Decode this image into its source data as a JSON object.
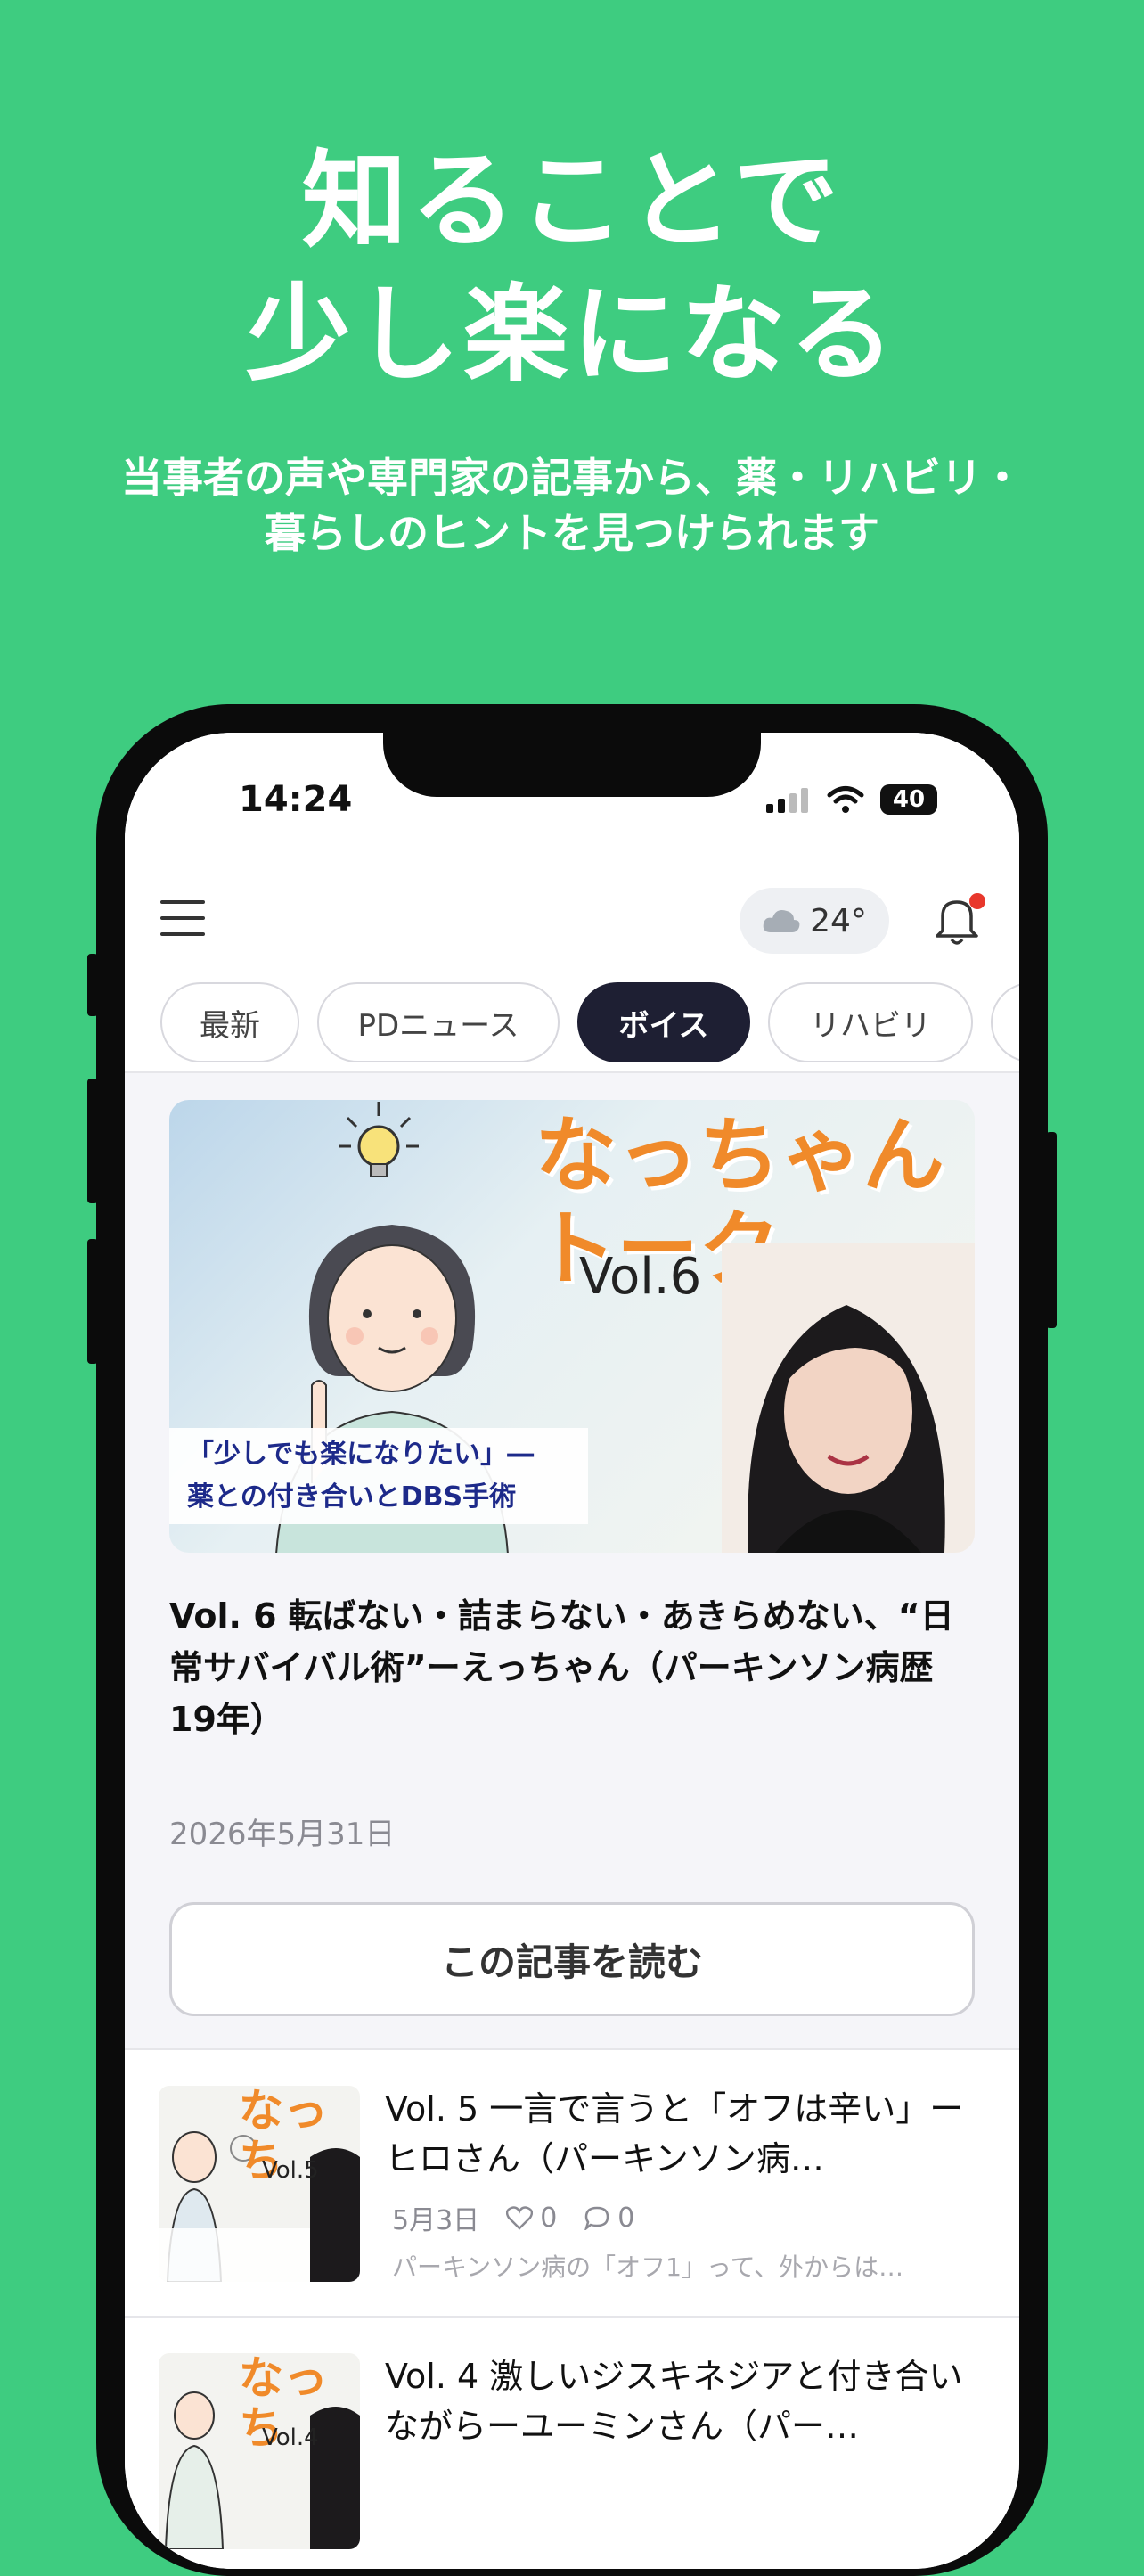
{
  "promo": {
    "headline_line1": "知ることで",
    "headline_line2": "少し楽になる",
    "subline_line1": "当事者の声や専門家の記事から、薬・リハビリ・",
    "subline_line2": "暮らしのヒントを見つけられます"
  },
  "status": {
    "time": "14:24",
    "battery": "40"
  },
  "appbar": {
    "temperature": "24°"
  },
  "tabs": [
    {
      "label": "最新"
    },
    {
      "label": "PDニュース"
    },
    {
      "label": "ボイス",
      "active": true
    },
    {
      "label": "リハビリ"
    }
  ],
  "featured": {
    "image_title": "なっちゃん トーク",
    "image_vol": "Vol.6",
    "image_caption_line1": "「少しでも楽になりたい」―",
    "image_caption_line2": "薬との付き合いとDBS手術",
    "title": "Vol. 6 転ばない・詰まらない・あきらめない、“日常サバイバル術”ーえっちゃん（パーキンソン病歴19年）",
    "date": "2026年5月31日",
    "read_button": "この記事を読む"
  },
  "articles": [
    {
      "thumb_title": "なっち",
      "thumb_vol": "Vol.5",
      "title": "Vol. 5 一言で言うと「オフは辛い」ーヒロさん（パーキンソン病…",
      "date": "5月3日",
      "likes": "0",
      "comments": "0",
      "excerpt": "パーキンソン病の「オフ1」って、外からは…"
    },
    {
      "thumb_title": "なっち",
      "thumb_vol": "Vol.4",
      "title": "Vol. 4 激しいジスキネジアと付き合いながらーユーミンさん（パー…",
      "date": "",
      "likes": "",
      "comments": "",
      "excerpt": ""
    }
  ],
  "colors": {
    "background": "#3ecc80",
    "active_tab": "#1e1f33",
    "accent_orange": "#f08a2a"
  }
}
